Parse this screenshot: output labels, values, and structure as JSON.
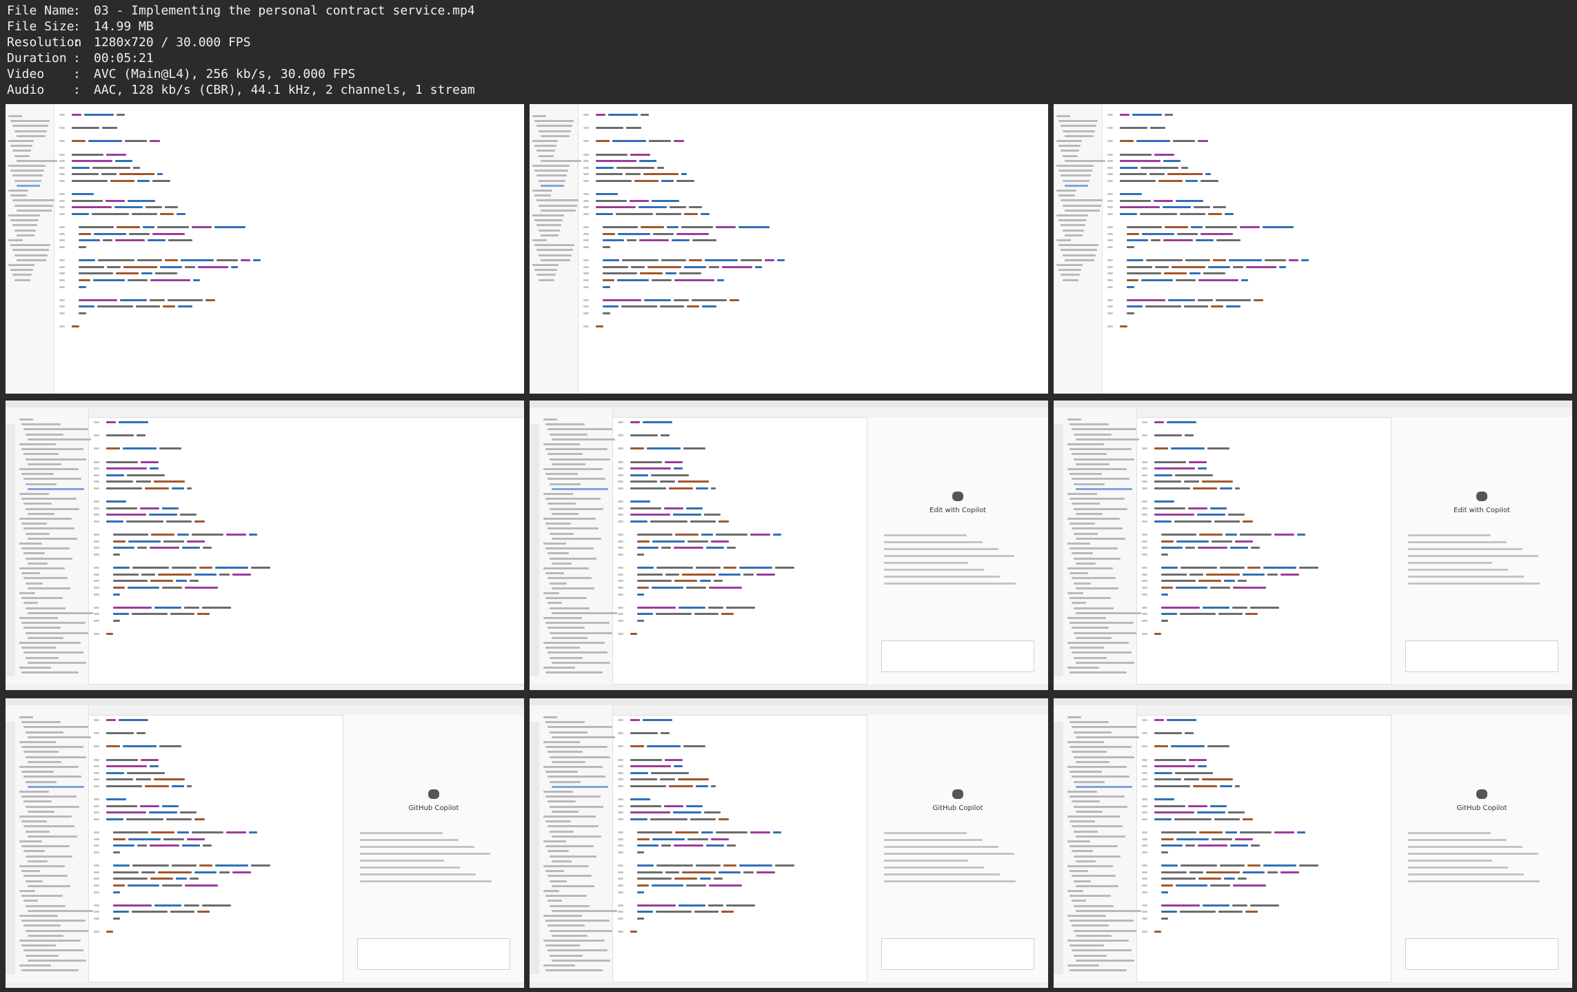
{
  "header": {
    "rows": [
      {
        "key": "File Name",
        "value": "03 - Implementing the personal contract service.mp4"
      },
      {
        "key": "File Size",
        "value": "14.99 MB"
      },
      {
        "key": "Resolution",
        "value": "1280x720 / 30.000 FPS"
      },
      {
        "key": "Duration",
        "value": "00:05:21"
      },
      {
        "key": "Video",
        "value": "AVC (Main@L4), 256 kb/s, 30.000 FPS"
      },
      {
        "key": "Audio",
        "value": "AAC, 128 kb/s (CBR), 44.1 kHz, 2 channels, 1 stream"
      }
    ]
  },
  "thumbnails": [
    {
      "kind": "code",
      "copilot": false
    },
    {
      "kind": "code",
      "copilot": false
    },
    {
      "kind": "code",
      "copilot": false
    },
    {
      "kind": "vscode",
      "copilot": false
    },
    {
      "kind": "vscode",
      "copilot": true,
      "panel_title": "Edit with Copilot"
    },
    {
      "kind": "vscode",
      "copilot": true,
      "panel_title": "Edit with Copilot"
    },
    {
      "kind": "vscode",
      "copilot": true,
      "panel_title": "GitHub Copilot"
    },
    {
      "kind": "vscode",
      "copilot": true,
      "panel_title": "GitHub Copilot"
    },
    {
      "kind": "vscode",
      "copilot": true,
      "panel_title": "GitHub Copilot"
    }
  ],
  "colors": {
    "keyword": "#9d3a9b",
    "type": "#2f6fb6",
    "string": "#a1562b",
    "plain": "#6b6b6b",
    "comment": "#2c8a3a",
    "highlight": "#cfe2ff"
  }
}
